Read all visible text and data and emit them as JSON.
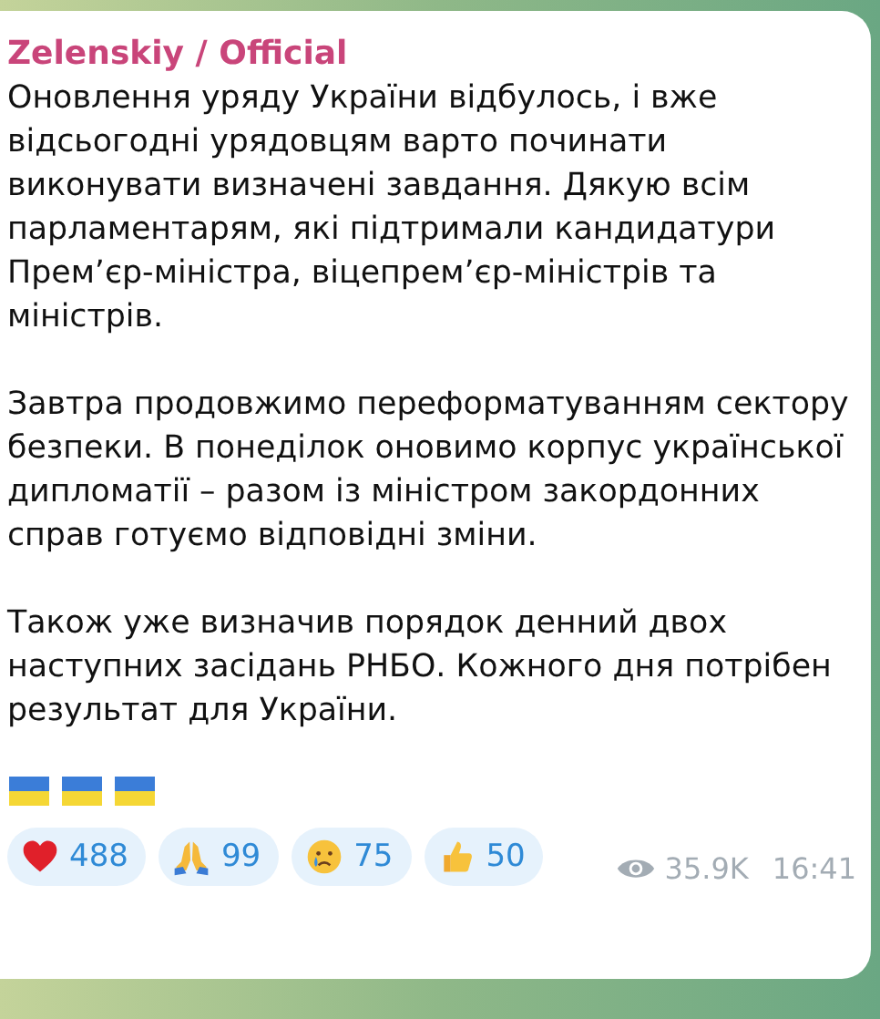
{
  "message": {
    "author": "Zelenskiy / Official",
    "paragraphs": [
      "Оновлення уряду України відбулось, і вже відсьогодні урядовцям варто починати виконувати визначені завдання. Дякую всім парламентарям, які підтримали кандидатури Прем’єр-міністра, віцепрем’єр-міністрів та міністрів.",
      "Завтра продовжимо переформатуванням сектору безпеки. В понеділок оновимо корпус української дипломатії – разом із міністром закордонних справ готуємо відповідні зміни.",
      "Також уже визначив порядок денний двох наступних засідань РНБО. Кожного дня потрібен результат для України."
    ],
    "flags": [
      {
        "kind": "ukraine"
      },
      {
        "kind": "ukraine"
      },
      {
        "kind": "ukraine"
      }
    ],
    "reactions": [
      {
        "kind": "heart",
        "count": "488"
      },
      {
        "kind": "pray",
        "count": "99"
      },
      {
        "kind": "cry",
        "count": "75"
      },
      {
        "kind": "thumbs",
        "count": "50"
      }
    ],
    "views": "35.9K",
    "time": "16:41"
  }
}
